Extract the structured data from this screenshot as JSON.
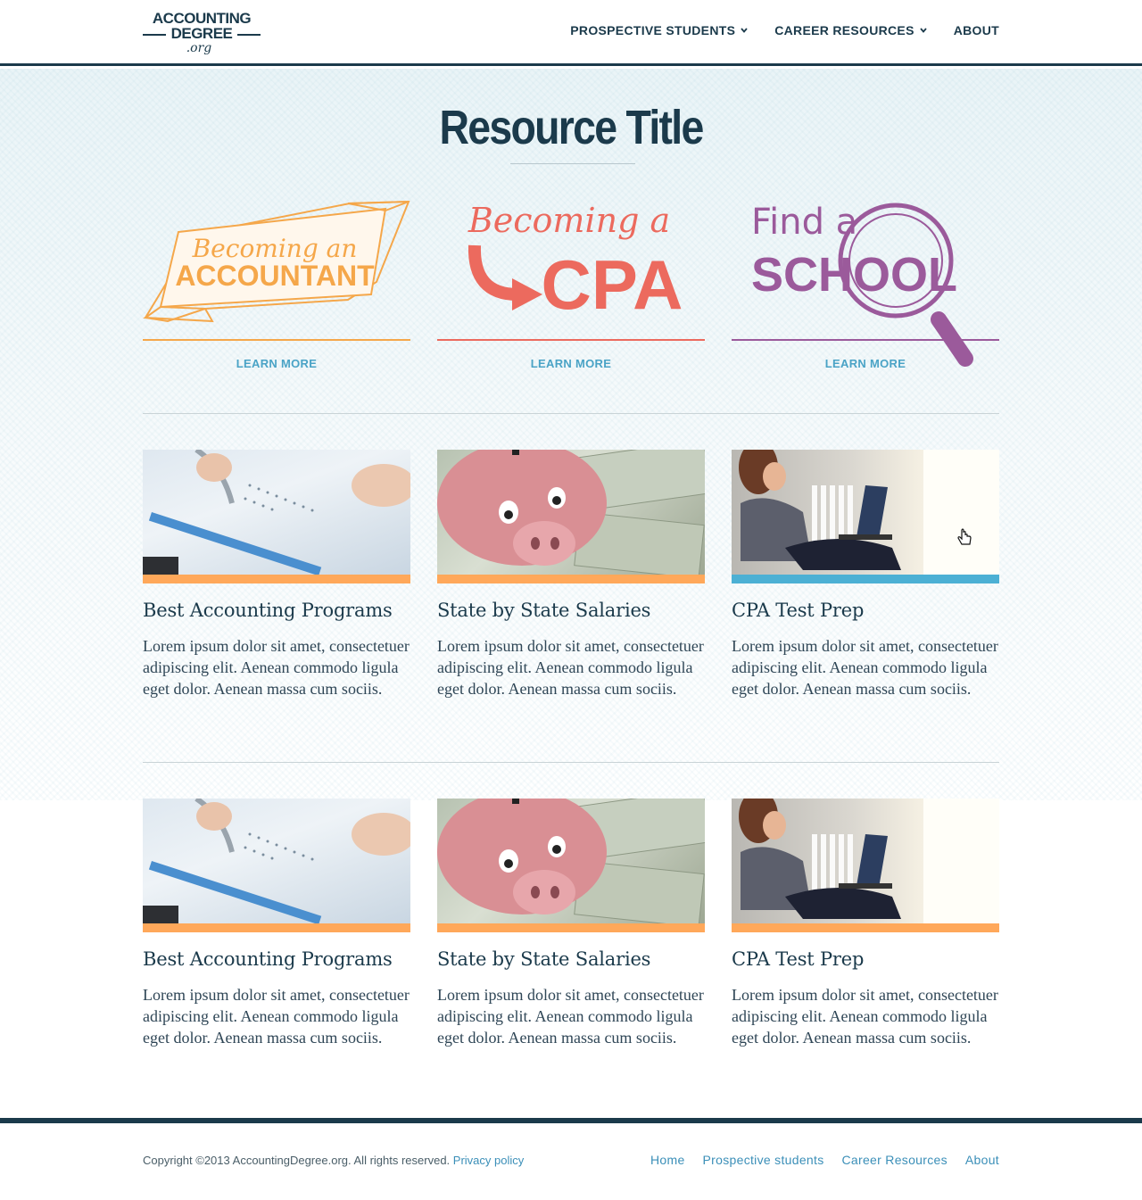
{
  "header": {
    "logo": {
      "line1": "ACCOUNTING",
      "line2": "DEGREE",
      "line3": ".org"
    },
    "nav": [
      {
        "label": "PROSPECTIVE STUDENTS",
        "has_dropdown": true
      },
      {
        "label": "CAREER RESOURCES",
        "has_dropdown": true
      },
      {
        "label": "ABOUT",
        "has_dropdown": false
      }
    ]
  },
  "main": {
    "title": "Resource Title",
    "promos": [
      {
        "line1": "Becoming an",
        "line2": "ACCOUNTANT",
        "cta": "LEARN MORE",
        "color": "#f5a74a"
      },
      {
        "line1": "Becoming a",
        "line2": "CPA",
        "cta": "LEARN MORE",
        "color": "#ec6a5e"
      },
      {
        "line1": "Find a",
        "line2": "SCHOOL",
        "cta": "LEARN MORE",
        "color": "#9b5a9b"
      }
    ],
    "card_rows": [
      [
        {
          "title": "Best Accounting Programs",
          "body": "Lorem ipsum dolor sit amet, consectetuer adipiscing elit. Aenean commodo ligula eget dolor. Aenean massa cum sociis.",
          "bar_color": "#ffa85a"
        },
        {
          "title": "State by State Salaries",
          "body": "Lorem ipsum dolor sit amet, consectetuer adipiscing elit. Aenean commodo ligula eget dolor. Aenean massa cum sociis.",
          "bar_color": "#ffa85a"
        },
        {
          "title": "CPA Test Prep",
          "body": "Lorem ipsum dolor sit amet, consectetuer adipiscing elit. Aenean commodo ligula eget dolor. Aenean massa cum sociis.",
          "bar_color": "#4cb0d4"
        }
      ],
      [
        {
          "title": "Best Accounting Programs",
          "body": "Lorem ipsum dolor sit amet, consectetuer adipiscing elit. Aenean commodo ligula eget dolor. Aenean massa cum sociis.",
          "bar_color": "#ffa85a"
        },
        {
          "title": "State by State Salaries",
          "body": "Lorem ipsum dolor sit amet, consectetuer adipiscing elit. Aenean commodo ligula eget dolor. Aenean massa cum sociis.",
          "bar_color": "#ffa85a"
        },
        {
          "title": "CPA Test Prep",
          "body": "Lorem ipsum dolor sit amet, consectetuer adipiscing elit. Aenean commodo ligula eget dolor. Aenean massa cum sociis.",
          "bar_color": "#ffa85a"
        }
      ]
    ]
  },
  "footer": {
    "copyright": "Copyright ©2013 AccountingDegree.org. All rights reserved.",
    "privacy": "Privacy policy",
    "links": [
      "Home",
      "Prospective students",
      "Career Resources",
      "About"
    ]
  },
  "colors": {
    "navy": "#1b3a4b",
    "link_blue": "#4aa3c6",
    "orange": "#ffa85a",
    "coral": "#ec6a5e",
    "purple": "#9b5a9b"
  }
}
